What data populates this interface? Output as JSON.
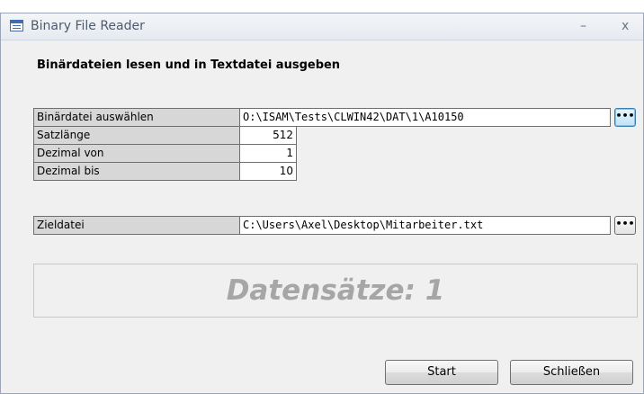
{
  "window": {
    "title": "Binary File Reader",
    "minimize_glyph": "–",
    "close_glyph": "x"
  },
  "form": {
    "heading": "Binärdateien lesen und in Textdatei ausgeben",
    "source_label": "Binärdatei auswählen",
    "source_path": "O:\\ISAM\\Tests\\CLWIN42\\DAT\\1\\A10150",
    "record_length_label": "Satzlänge",
    "record_length": "512",
    "decimal_from_label": "Dezimal von",
    "decimal_from": "1",
    "decimal_to_label": "Dezimal bis",
    "decimal_to": "10",
    "target_label": "Zieldatei",
    "target_path": "C:\\Users\\Axel\\Desktop\\Mitarbeiter.txt",
    "browse_label": "•••",
    "records_text": "Datensätze: 1"
  },
  "buttons": {
    "start": "Start",
    "close": "Schließen"
  },
  "icons": {
    "app": "form-icon",
    "browse": "ellipsis-icon"
  }
}
